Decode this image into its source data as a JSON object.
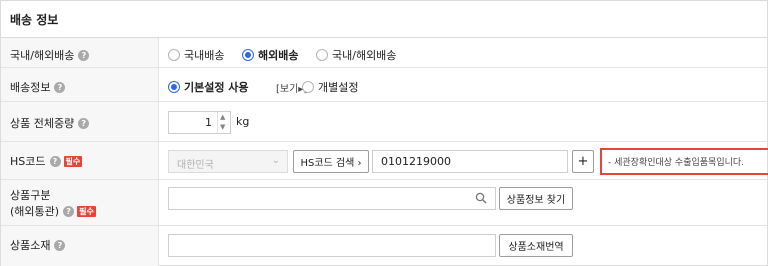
{
  "section_title": "배송 정보",
  "rows": {
    "shipping_type": {
      "label": "국내/해외배송",
      "options": [
        "국내배송",
        "해외배송",
        "국내/해외배송"
      ],
      "selected": "해외배송"
    },
    "shipping_info": {
      "label": "배송정보",
      "options": [
        "기본설정 사용",
        "개별설정"
      ],
      "selected": "기본설정 사용",
      "view_link": "[보기▸]"
    },
    "weight": {
      "label": "상품 전체중량",
      "value": "1",
      "unit": "kg"
    },
    "hs_code": {
      "label": "HS코드",
      "required": "필수",
      "country": "대한민국",
      "search_button": "HS코드 검색 ›",
      "code": "0101219000",
      "add_button": "+",
      "notice": "- 세관장확인대상 수출입품목입니다."
    },
    "category": {
      "label_line1": "상품구분",
      "label_line2": "(해외통관)",
      "required": "필수",
      "search_value": "",
      "find_button": "상품정보 찾기"
    },
    "material": {
      "label": "상품소재",
      "value": "",
      "translate_button": "상품소재번역"
    }
  },
  "help_symbol": "?",
  "colors": {
    "accent": "#2f66e8",
    "required": "#e8443a"
  }
}
